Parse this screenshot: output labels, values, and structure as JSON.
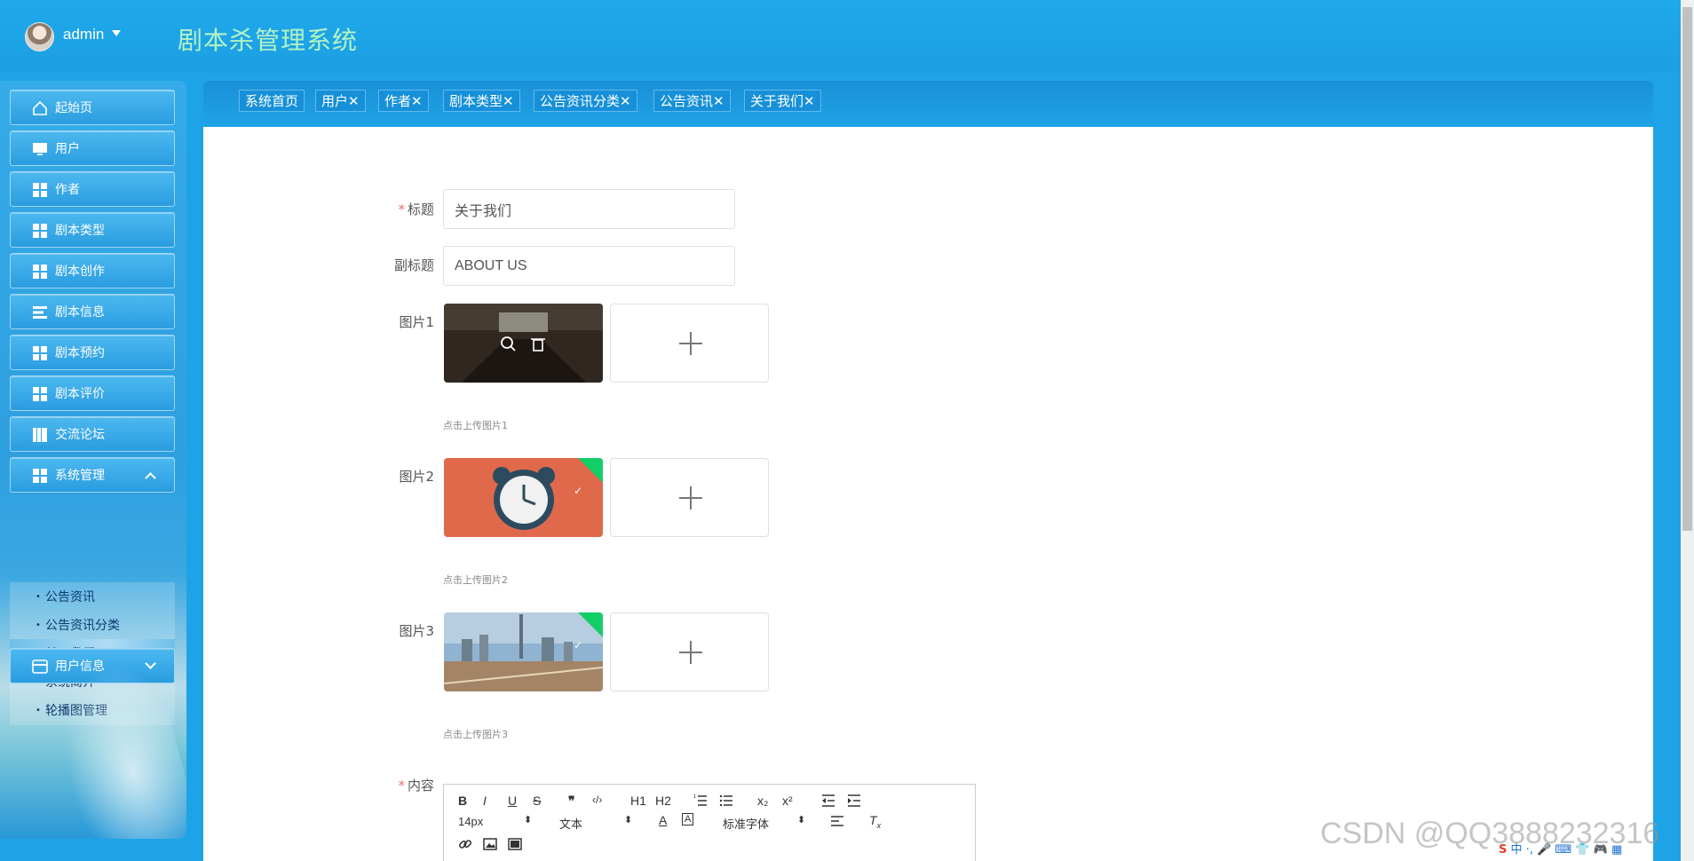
{
  "header": {
    "username": "admin",
    "app_title": "剧本杀管理系统"
  },
  "sidebar": {
    "items": [
      {
        "label": "起始页",
        "icon": "home-icon"
      },
      {
        "label": "用户",
        "icon": "monitor-icon"
      },
      {
        "label": "作者",
        "icon": "grid-icon"
      },
      {
        "label": "剧本类型",
        "icon": "grid-icon"
      },
      {
        "label": "剧本创作",
        "icon": "grid-icon"
      },
      {
        "label": "剧本信息",
        "icon": "list-icon"
      },
      {
        "label": "剧本预约",
        "icon": "grid-icon"
      },
      {
        "label": "剧本评价",
        "icon": "grid-icon"
      },
      {
        "label": "交流论坛",
        "icon": "book-icon"
      },
      {
        "label": "系统管理",
        "icon": "grid-icon"
      },
      {
        "label": "用户信息",
        "icon": "card-icon"
      }
    ],
    "submenu": [
      {
        "label": "公告资讯"
      },
      {
        "label": "公告资讯分类"
      },
      {
        "label": "关于我们",
        "active": true
      },
      {
        "label": "系统简介"
      },
      {
        "label": "轮播图管理"
      }
    ]
  },
  "tabs": [
    {
      "label": "系统首页"
    },
    {
      "label": "用户✕"
    },
    {
      "label": "作者✕"
    },
    {
      "label": "剧本类型✕"
    },
    {
      "label": "公告资讯分类✕"
    },
    {
      "label": "公告资讯✕"
    },
    {
      "label": "关于我们✕"
    }
  ],
  "form": {
    "title_label": "标题",
    "title_value": "关于我们",
    "subtitle_label": "副标题",
    "subtitle_value": "ABOUT US",
    "image1_label": "图片1",
    "image1_hint": "点击上传图片1",
    "image2_label": "图片2",
    "image2_hint": "点击上传图片2",
    "image3_label": "图片3",
    "image3_hint": "点击上传图片3",
    "content_label": "内容",
    "required_mark": "*",
    "check_mark": "✓"
  },
  "editor": {
    "bold": "B",
    "italic": "I",
    "underline": "U",
    "strike": "S",
    "quote": "❞",
    "code": "‹/›",
    "h1": "H1",
    "h2": "H2",
    "subscript": "x₂",
    "superscript": "x²",
    "font_size": "14px",
    "text_type": "文本",
    "font_family": "标准字体"
  },
  "watermark": "CSDN @QQ3888232316",
  "colors": {
    "accent": "#1ea4e6",
    "title_green": "#b5f2c2",
    "success": "#13ce66",
    "required": "#f56c6c"
  }
}
